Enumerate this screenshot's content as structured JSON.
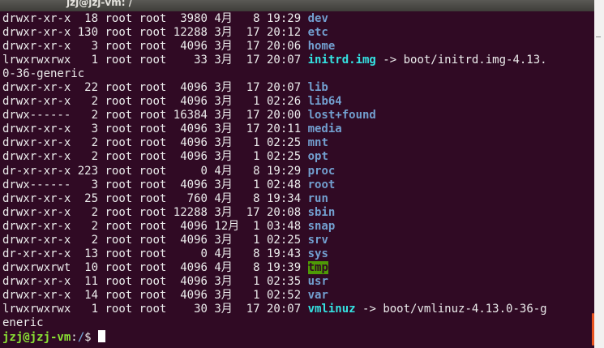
{
  "window": {
    "title": "jzj@jzj-vm: /"
  },
  "listing": [
    {
      "perm": "drwxr-xr-x",
      "links": "18",
      "owner": "root",
      "group": "root",
      "size": "3980",
      "month": "4月",
      "day": "8",
      "time": "19:29",
      "name": "dev",
      "type": "dir"
    },
    {
      "perm": "drwxr-xr-x",
      "links": "130",
      "owner": "root",
      "group": "root",
      "size": "12288",
      "month": "3月",
      "day": "17",
      "time": "20:12",
      "name": "etc",
      "type": "dir"
    },
    {
      "perm": "drwxr-xr-x",
      "links": "3",
      "owner": "root",
      "group": "root",
      "size": "4096",
      "month": "3月",
      "day": "17",
      "time": "20:06",
      "name": "home",
      "type": "dir"
    },
    {
      "perm": "lrwxrwxrwx",
      "links": "1",
      "owner": "root",
      "group": "root",
      "size": "33",
      "month": "3月",
      "day": "17",
      "time": "20:07",
      "name": "initrd.img",
      "type": "link",
      "target": "boot/initrd.img-4.13.0-36-generic"
    },
    {
      "perm": "drwxr-xr-x",
      "links": "22",
      "owner": "root",
      "group": "root",
      "size": "4096",
      "month": "3月",
      "day": "17",
      "time": "20:07",
      "name": "lib",
      "type": "dir"
    },
    {
      "perm": "drwxr-xr-x",
      "links": "2",
      "owner": "root",
      "group": "root",
      "size": "4096",
      "month": "3月",
      "day": "1",
      "time": "02:26",
      "name": "lib64",
      "type": "dir"
    },
    {
      "perm": "drwx------",
      "links": "2",
      "owner": "root",
      "group": "root",
      "size": "16384",
      "month": "3月",
      "day": "17",
      "time": "20:00",
      "name": "lost+found",
      "type": "dir"
    },
    {
      "perm": "drwxr-xr-x",
      "links": "3",
      "owner": "root",
      "group": "root",
      "size": "4096",
      "month": "3月",
      "day": "17",
      "time": "20:11",
      "name": "media",
      "type": "dir"
    },
    {
      "perm": "drwxr-xr-x",
      "links": "2",
      "owner": "root",
      "group": "root",
      "size": "4096",
      "month": "3月",
      "day": "1",
      "time": "02:25",
      "name": "mnt",
      "type": "dir"
    },
    {
      "perm": "drwxr-xr-x",
      "links": "2",
      "owner": "root",
      "group": "root",
      "size": "4096",
      "month": "3月",
      "day": "1",
      "time": "02:25",
      "name": "opt",
      "type": "dir"
    },
    {
      "perm": "dr-xr-xr-x",
      "links": "223",
      "owner": "root",
      "group": "root",
      "size": "0",
      "month": "4月",
      "day": "8",
      "time": "19:29",
      "name": "proc",
      "type": "dir"
    },
    {
      "perm": "drwx------",
      "links": "3",
      "owner": "root",
      "group": "root",
      "size": "4096",
      "month": "3月",
      "day": "1",
      "time": "02:48",
      "name": "root",
      "type": "dir"
    },
    {
      "perm": "drwxr-xr-x",
      "links": "25",
      "owner": "root",
      "group": "root",
      "size": "760",
      "month": "4月",
      "day": "8",
      "time": "19:34",
      "name": "run",
      "type": "dir"
    },
    {
      "perm": "drwxr-xr-x",
      "links": "2",
      "owner": "root",
      "group": "root",
      "size": "12288",
      "month": "3月",
      "day": "17",
      "time": "20:08",
      "name": "sbin",
      "type": "dir"
    },
    {
      "perm": "drwxr-xr-x",
      "links": "2",
      "owner": "root",
      "group": "root",
      "size": "4096",
      "month": "12月",
      "day": "1",
      "time": "03:48",
      "name": "snap",
      "type": "dir"
    },
    {
      "perm": "drwxr-xr-x",
      "links": "2",
      "owner": "root",
      "group": "root",
      "size": "4096",
      "month": "3月",
      "day": "1",
      "time": "02:25",
      "name": "srv",
      "type": "dir"
    },
    {
      "perm": "dr-xr-xr-x",
      "links": "13",
      "owner": "root",
      "group": "root",
      "size": "0",
      "month": "4月",
      "day": "8",
      "time": "19:43",
      "name": "sys",
      "type": "dir"
    },
    {
      "perm": "drwxrwxrwt",
      "links": "10",
      "owner": "root",
      "group": "root",
      "size": "4096",
      "month": "4月",
      "day": "8",
      "time": "19:39",
      "name": "tmp",
      "type": "sticky"
    },
    {
      "perm": "drwxr-xr-x",
      "links": "11",
      "owner": "root",
      "group": "root",
      "size": "4096",
      "month": "3月",
      "day": "1",
      "time": "02:35",
      "name": "usr",
      "type": "dir"
    },
    {
      "perm": "drwxr-xr-x",
      "links": "14",
      "owner": "root",
      "group": "root",
      "size": "4096",
      "month": "3月",
      "day": "1",
      "time": "02:52",
      "name": "var",
      "type": "dir"
    },
    {
      "perm": "lrwxrwxrwx",
      "links": "1",
      "owner": "root",
      "group": "root",
      "size": "30",
      "month": "3月",
      "day": "17",
      "time": "20:07",
      "name": "vmlinuz",
      "type": "link",
      "target": "boot/vmlinuz-4.13.0-36-generic"
    }
  ],
  "prompt": {
    "user_host": "jzj@jzj-vm",
    "separator": ":",
    "path": "/",
    "symbol": "$ "
  },
  "colors": {
    "background": "#300a24",
    "text": "#ececec",
    "dir": "#729fcf",
    "link": "#34e2e2",
    "sticky_bg": "#4e9a06",
    "prompt_user": "#8ae234",
    "cursor": "#ffffff",
    "scroll_thumb": "#e95420"
  },
  "icons": {
    "cursor": "block-cursor"
  }
}
